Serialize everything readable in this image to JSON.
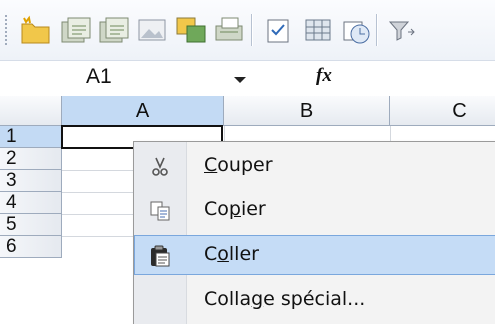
{
  "toolbar": {
    "buttons": [
      {
        "name": "new-folder-icon"
      },
      {
        "name": "open-icon"
      },
      {
        "name": "save-icon"
      },
      {
        "name": "image-icon"
      },
      {
        "name": "copy-table-icon"
      },
      {
        "name": "print-icon"
      },
      {
        "name": "checkbox-icon"
      },
      {
        "name": "table-icon"
      },
      {
        "name": "mail-icon"
      },
      {
        "name": "filter-icon"
      }
    ]
  },
  "formula_bar": {
    "name_box": "A1",
    "fx_label": "fx"
  },
  "grid": {
    "columns": [
      "A",
      "B",
      "C"
    ],
    "rows": [
      "1",
      "2",
      "3",
      "4",
      "5",
      "6"
    ]
  },
  "context_menu": {
    "items": [
      {
        "label_pre": "",
        "label_key": "C",
        "label_post": "ouper",
        "icon": "scissors-icon"
      },
      {
        "label_pre": "Co",
        "label_key": "p",
        "label_post": "ier",
        "icon": "copy-icon"
      },
      {
        "label_pre": "C",
        "label_key": "o",
        "label_post": "ller",
        "icon": "paste-icon"
      },
      {
        "label_pre": "Colla",
        "label_key": "g",
        "label_post": "e spécial...",
        "icon": ""
      }
    ],
    "highlighted_index": 2
  }
}
